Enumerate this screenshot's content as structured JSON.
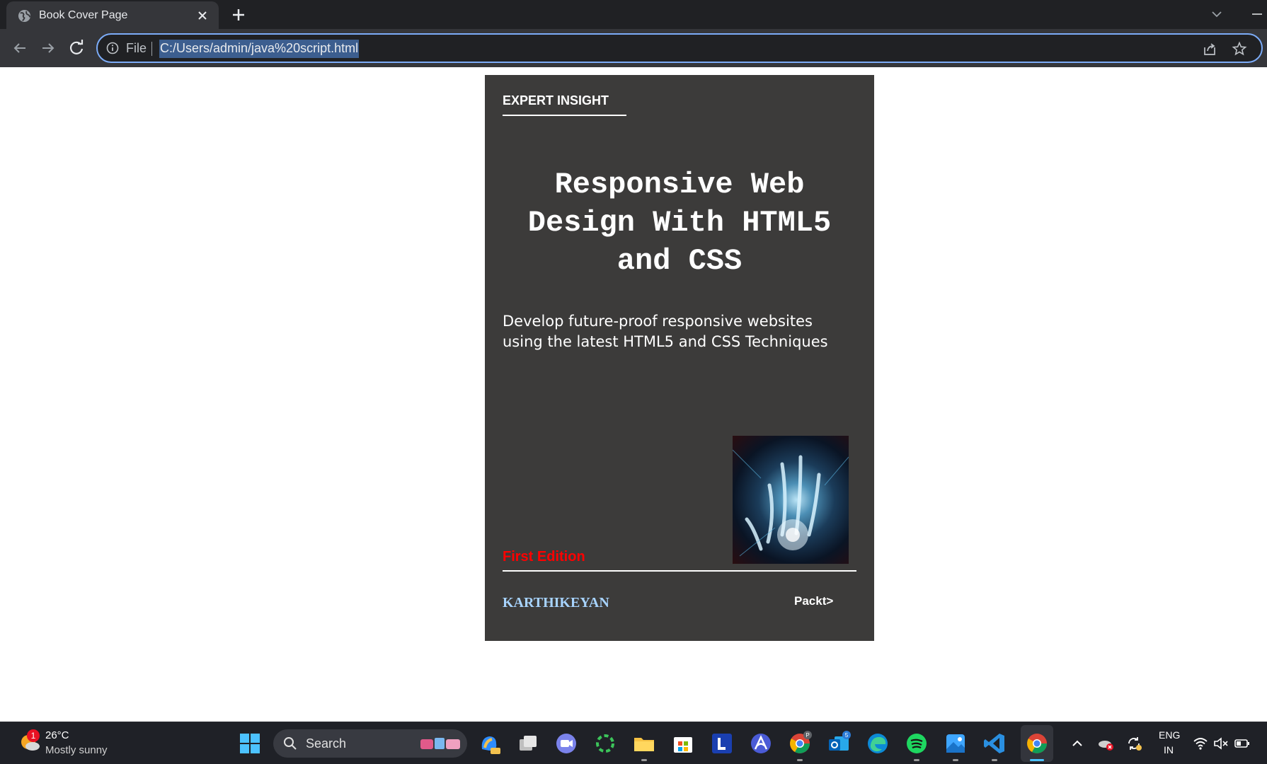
{
  "browser": {
    "tab": {
      "title": "Book Cover Page",
      "icon": "globe-icon"
    },
    "address_bar": {
      "scheme_label": "File",
      "url": "C:/Users/admin/java%20script.html"
    },
    "accent_color": "#7cacf8"
  },
  "book_cover": {
    "series_label": "EXPERT INSIGHT",
    "title": "Responsive Web Design With HTML5 and CSS",
    "subtitle": "Develop future-proof responsive websites using the latest HTML5 and CSS Techniques",
    "edition": "First Edition",
    "author": "KARTHIKEYAN",
    "publisher": "Packt>",
    "background_color": "#3c3b3a",
    "edition_color": "#ff0000",
    "author_color": "#a8d4ff"
  },
  "taskbar": {
    "weather": {
      "temperature": "26°C",
      "condition": "Mostly sunny",
      "badge": "1"
    },
    "search_label": "Search",
    "pinned_apps": [
      "copilot-icon",
      "task-view-icon",
      "teams-meet-icon",
      "loading-app-icon",
      "file-explorer-icon",
      "microsoft-store-icon",
      "l-app-icon",
      "arc-app-icon",
      "chrome-profile-icon",
      "outlook-icon",
      "edge-icon",
      "spotify-icon",
      "photos-icon",
      "vscode-icon",
      "chrome-icon"
    ],
    "chrome_profile_badge": "P",
    "outlook_badge": "5",
    "language": {
      "line1": "ENG",
      "line2": "IN"
    }
  }
}
